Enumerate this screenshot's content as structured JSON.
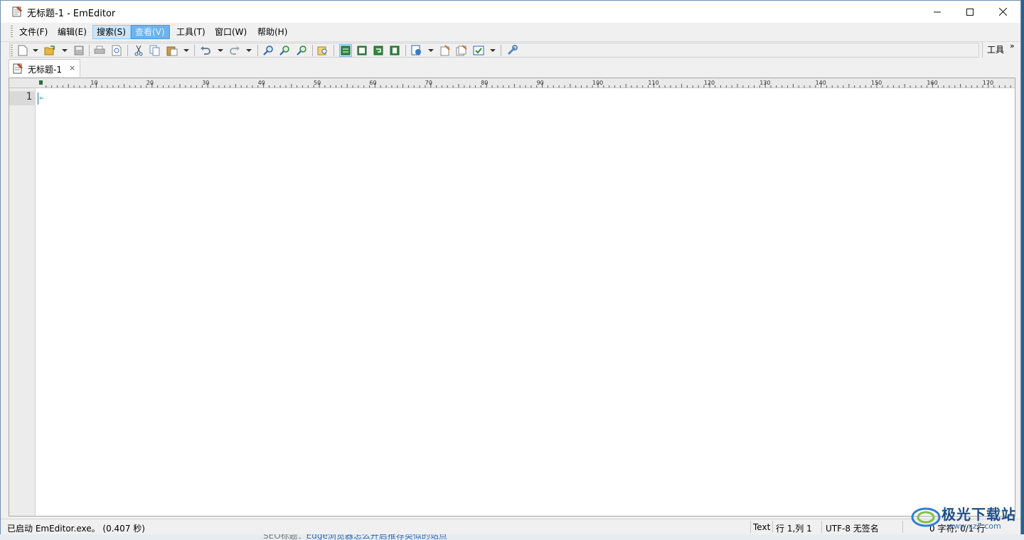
{
  "window": {
    "title": "无标题-1 - EmEditor"
  },
  "menu": {
    "items": [
      {
        "label": "文件(F)"
      },
      {
        "label": "编辑(E)"
      },
      {
        "label": "搜索(S)"
      },
      {
        "label": "查看(V)"
      },
      {
        "label": "工具(T)"
      },
      {
        "label": "窗口(W)"
      },
      {
        "label": "帮助(H)"
      }
    ]
  },
  "toolbar": {
    "tools_label": "工具",
    "overflow": "»",
    "icons": [
      "new-file-icon",
      "open-folder-icon",
      "save-icon",
      "print-icon",
      "print-preview-icon",
      "cut-icon",
      "copy-icon",
      "paste-icon",
      "undo-icon",
      "redo-icon",
      "find-icon",
      "find-next-icon",
      "find-previous-icon",
      "find-in-files-icon",
      "wrap-none-icon",
      "wrap-chars-icon",
      "wrap-window-icon",
      "wrap-page-icon",
      "encoding-icon",
      "macro-record-icon",
      "macro-run-icon",
      "properties-icon",
      "customize-icon"
    ]
  },
  "tabs": [
    {
      "label": "无标题-1",
      "close": "×"
    }
  ],
  "ruler": {
    "labels": [
      "10",
      "20",
      "30",
      "40",
      "50",
      "60",
      "70",
      "80",
      "90",
      "100",
      "110",
      "120",
      "130",
      "140",
      "150",
      "160",
      "170"
    ]
  },
  "editor": {
    "line_numbers": [
      "1"
    ],
    "eol_mark": "←"
  },
  "status": {
    "message": "已启动 EmEditor.exe。 (0.407 秒)",
    "mode": "Text",
    "position": "行 1,列 1",
    "encoding": "UTF-8 无签名",
    "count": "0 字符, 0/1 行"
  },
  "background": {
    "snippet_label": "SEO标题：",
    "snippet_text": "Edge浏览器怎么开启推荐类似的站点"
  },
  "watermark": {
    "text": "极光下载站",
    "url": "www.xz7.com"
  },
  "colors": {
    "accent": "#1a6fb0",
    "menu_highlight": "#6fb2ea",
    "frame": "#6d8fb1"
  }
}
